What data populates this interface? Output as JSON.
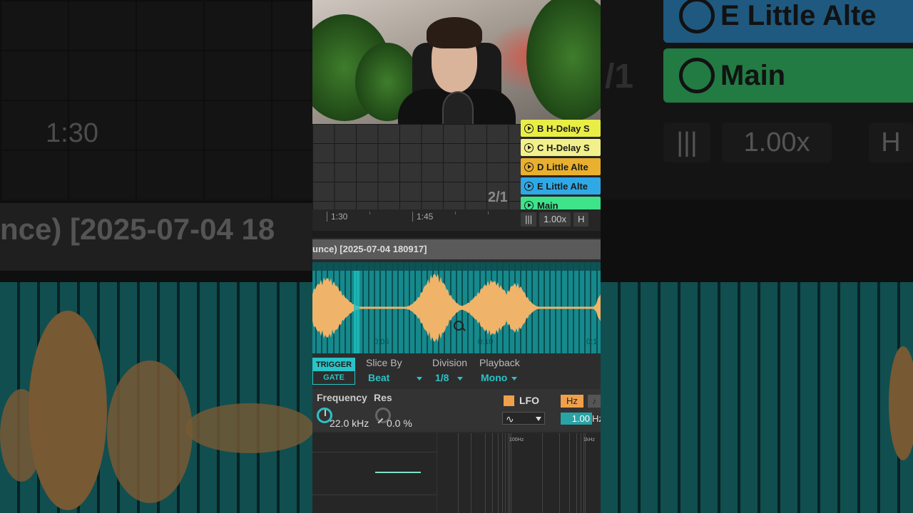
{
  "background": {
    "left_time": "1:30",
    "title_fragment": "nce) [2025-07-04 18",
    "right_clips": [
      {
        "label": "E Little Alte",
        "color": "#3aa3e8"
      },
      {
        "label": "Main",
        "color": "#3ee07a"
      }
    ],
    "right_scene": "/1",
    "right_tempo": "1.00x",
    "right_h": "H"
  },
  "session": {
    "clips": [
      {
        "label": "B H-Delay S",
        "color": "#e9ee46"
      },
      {
        "label": "C H-Delay S",
        "color": "#f2f08a"
      },
      {
        "label": "D Little Alte",
        "color": "#e8b02e"
      },
      {
        "label": "E Little Alte",
        "color": "#2fa9e6"
      },
      {
        "label": "Main",
        "color": "#3de48a"
      }
    ],
    "scene_number": "2/1"
  },
  "ruler": {
    "ticks": [
      "1:30",
      "1:45"
    ],
    "tempo_multiplier": "1.00x",
    "h_button": "H"
  },
  "device": {
    "title": "unce) [2025-07-04 180917]",
    "wave_times": [
      "0:05",
      "0:10",
      "0:1"
    ],
    "trigger_label": "TRIGGER",
    "gate_label": "GATE",
    "slice_by_label": "Slice By",
    "slice_by_value": "Beat",
    "division_label": "Division",
    "division_value": "1/8",
    "playback_label": "Playback",
    "playback_value": "Mono",
    "frequency_label": "Frequency",
    "frequency_value": "22.0 kHz",
    "res_label": "Res",
    "res_value": "0.0 %",
    "lfo_label": "LFO",
    "hz_label": "Hz",
    "hz_alt_label": "♪",
    "lfo_shape": "∿",
    "lfo_rate": "1.00",
    "lfo_rate_unit": "Hz"
  },
  "analyzer": {
    "labels": [
      "100Hz",
      "1kHz"
    ]
  },
  "colors": {
    "accent": "#29c3c8",
    "waveform": "#f0b36a",
    "waveform_bg": "#16898c"
  }
}
